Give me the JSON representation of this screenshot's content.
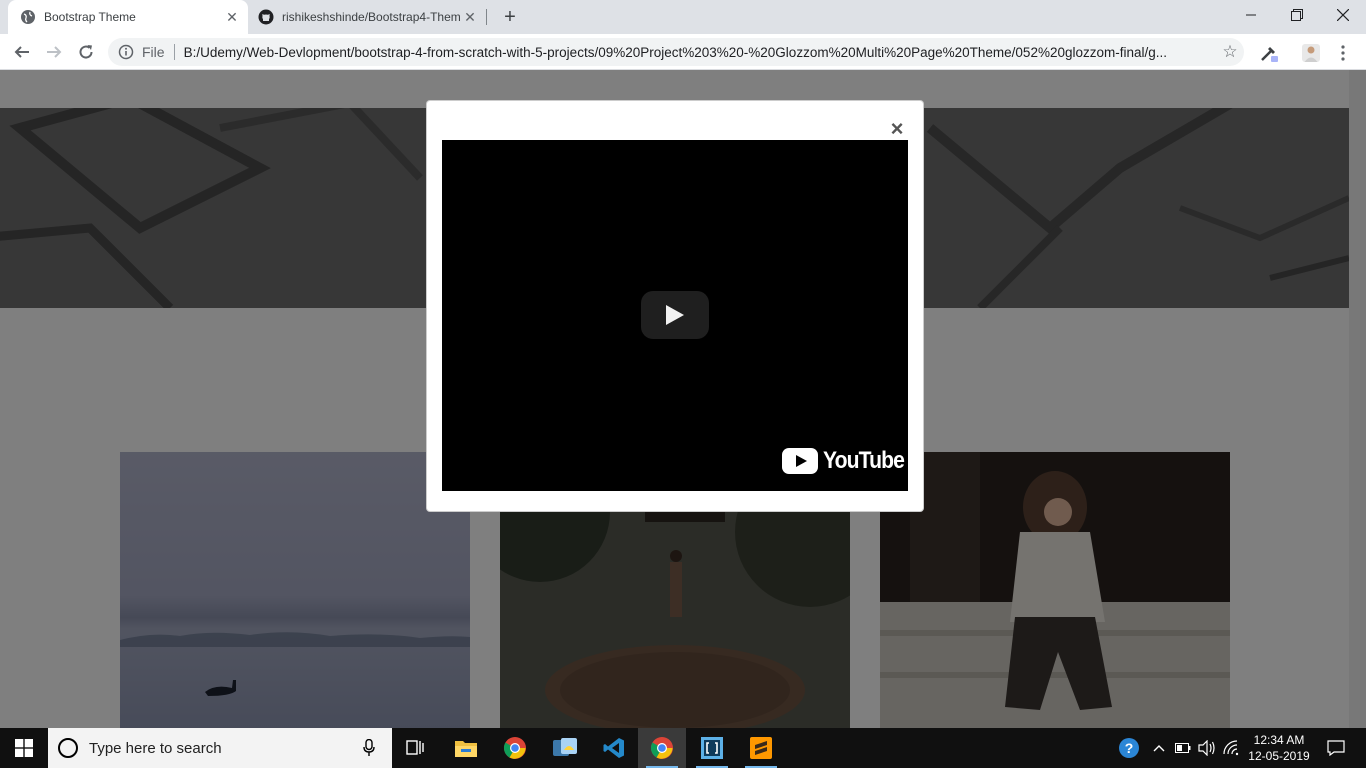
{
  "browser": {
    "tabs": [
      {
        "title": "Bootstrap Theme",
        "active": true,
        "icon": "globe-icon"
      },
      {
        "title": "rishikeshshinde/Bootstrap4-Theme",
        "active": false,
        "icon": "github-icon"
      }
    ],
    "new_tab_label": "+",
    "window_controls": {
      "minimize": "—",
      "restore": "❐",
      "close": "✕"
    },
    "address": {
      "scheme_label": "File",
      "url": "B:/Udemy/Web-Devlopment/bootstrap-4-from-scratch-with-5-projects/09%20Project%203%20-%20Glozzom%20Multi%20Page%20Theme/052%20glozzom-final/g..."
    }
  },
  "modal": {
    "close_label": "×",
    "video": {
      "brand_text": "YouTube",
      "play_icon": "play-icon"
    }
  },
  "taskbar": {
    "search_placeholder": "Type here to search",
    "apps": [
      "task-view-icon",
      "file-explorer-icon",
      "chrome-icon",
      "python-icon",
      "vscode-icon",
      "chrome-icon",
      "bracket-app-icon",
      "sublime-text-icon"
    ],
    "clock": {
      "time": "12:34 AM",
      "date": "12-05-2019"
    }
  },
  "colors": {
    "taskbar_bg": "#101010",
    "tabstrip_bg": "#dee1e6",
    "backdrop": "rgba(0,0,0,0.5)",
    "accent": "#76b9ed"
  }
}
